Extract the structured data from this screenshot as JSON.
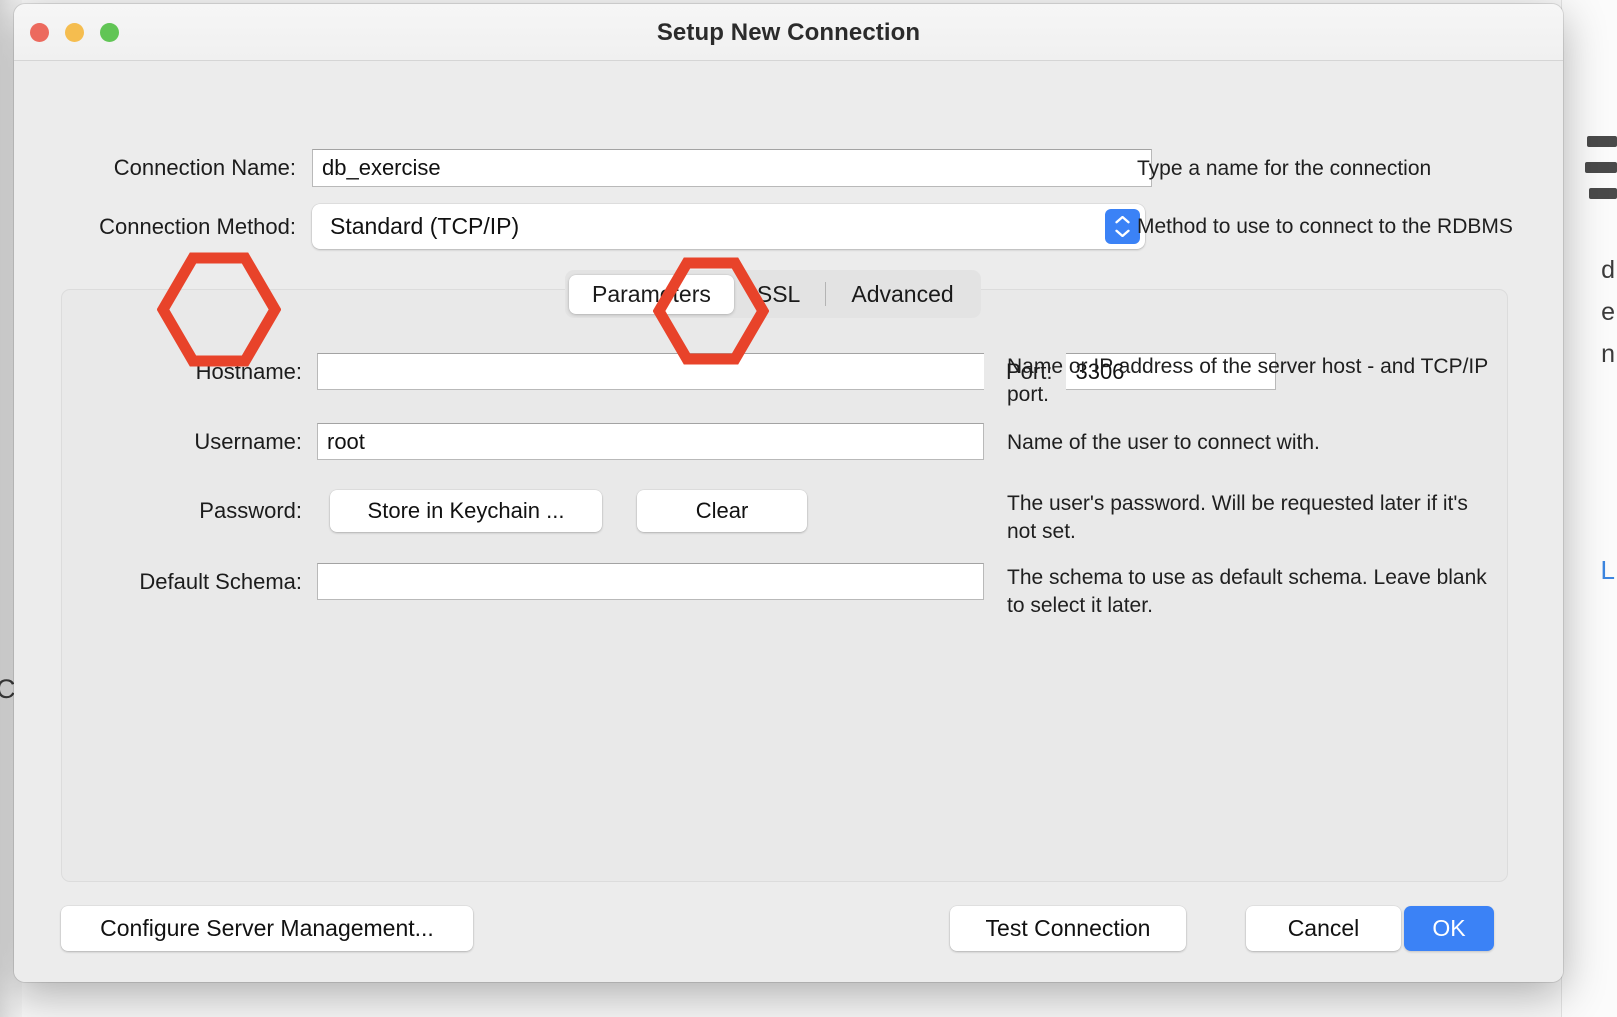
{
  "window": {
    "title": "Setup New Connection",
    "traffic_lights": [
      {
        "name": "close",
        "color": "#ec6a5e"
      },
      {
        "name": "minimize",
        "color": "#f5bd4f"
      },
      {
        "name": "maximize",
        "color": "#61c555"
      }
    ]
  },
  "form": {
    "connection_name": {
      "label": "Connection Name:",
      "value": "db_exercise",
      "placeholder": "",
      "hint": "Type a name for the connection"
    },
    "connection_method": {
      "label": "Connection Method:",
      "value": "Standard (TCP/IP)",
      "hint": "Method to use to connect to the RDBMS",
      "stepper_icon": "chevron-up-down-icon"
    }
  },
  "tabs": [
    {
      "label": "Parameters",
      "active": true
    },
    {
      "label": "SSL",
      "active": false
    },
    {
      "label": "Advanced",
      "active": false
    }
  ],
  "parameters": {
    "hostname": {
      "label": "Hostname:",
      "value": "",
      "placeholder": "",
      "hint": "Name or IP address of the server host - and TCP/IP port."
    },
    "port": {
      "label": "Port:",
      "value": "3306",
      "placeholder": ""
    },
    "username": {
      "label": "Username:",
      "value": "root",
      "placeholder": "",
      "hint": "Name of the user to connect with."
    },
    "password": {
      "label": "Password:",
      "keychain_button": "Store in Keychain ...",
      "clear_button": "Clear",
      "hint": "The user's password. Will be requested later if it's not set."
    },
    "default_schema": {
      "label": "Default Schema:",
      "value": "",
      "placeholder": "",
      "hint": "The schema to use as default schema. Leave blank to select it later."
    }
  },
  "footer": {
    "configure": "Configure Server Management...",
    "test_connection": "Test Connection",
    "cancel": "Cancel",
    "ok": "OK"
  },
  "annotations": {
    "color": "#e8432a",
    "shapes": [
      {
        "name": "hostname-highlight",
        "target": "Hostname:"
      },
      {
        "name": "port-highlight",
        "target": "Port:"
      }
    ]
  },
  "colors": {
    "accent_blue": "#3b82f6",
    "window_bg": "#ececec",
    "panel_bg": "#e9e9e9",
    "annotation_red": "#e8432a"
  },
  "background_window": {
    "left_glyph": "C",
    "right_blue_glyph": "L"
  }
}
